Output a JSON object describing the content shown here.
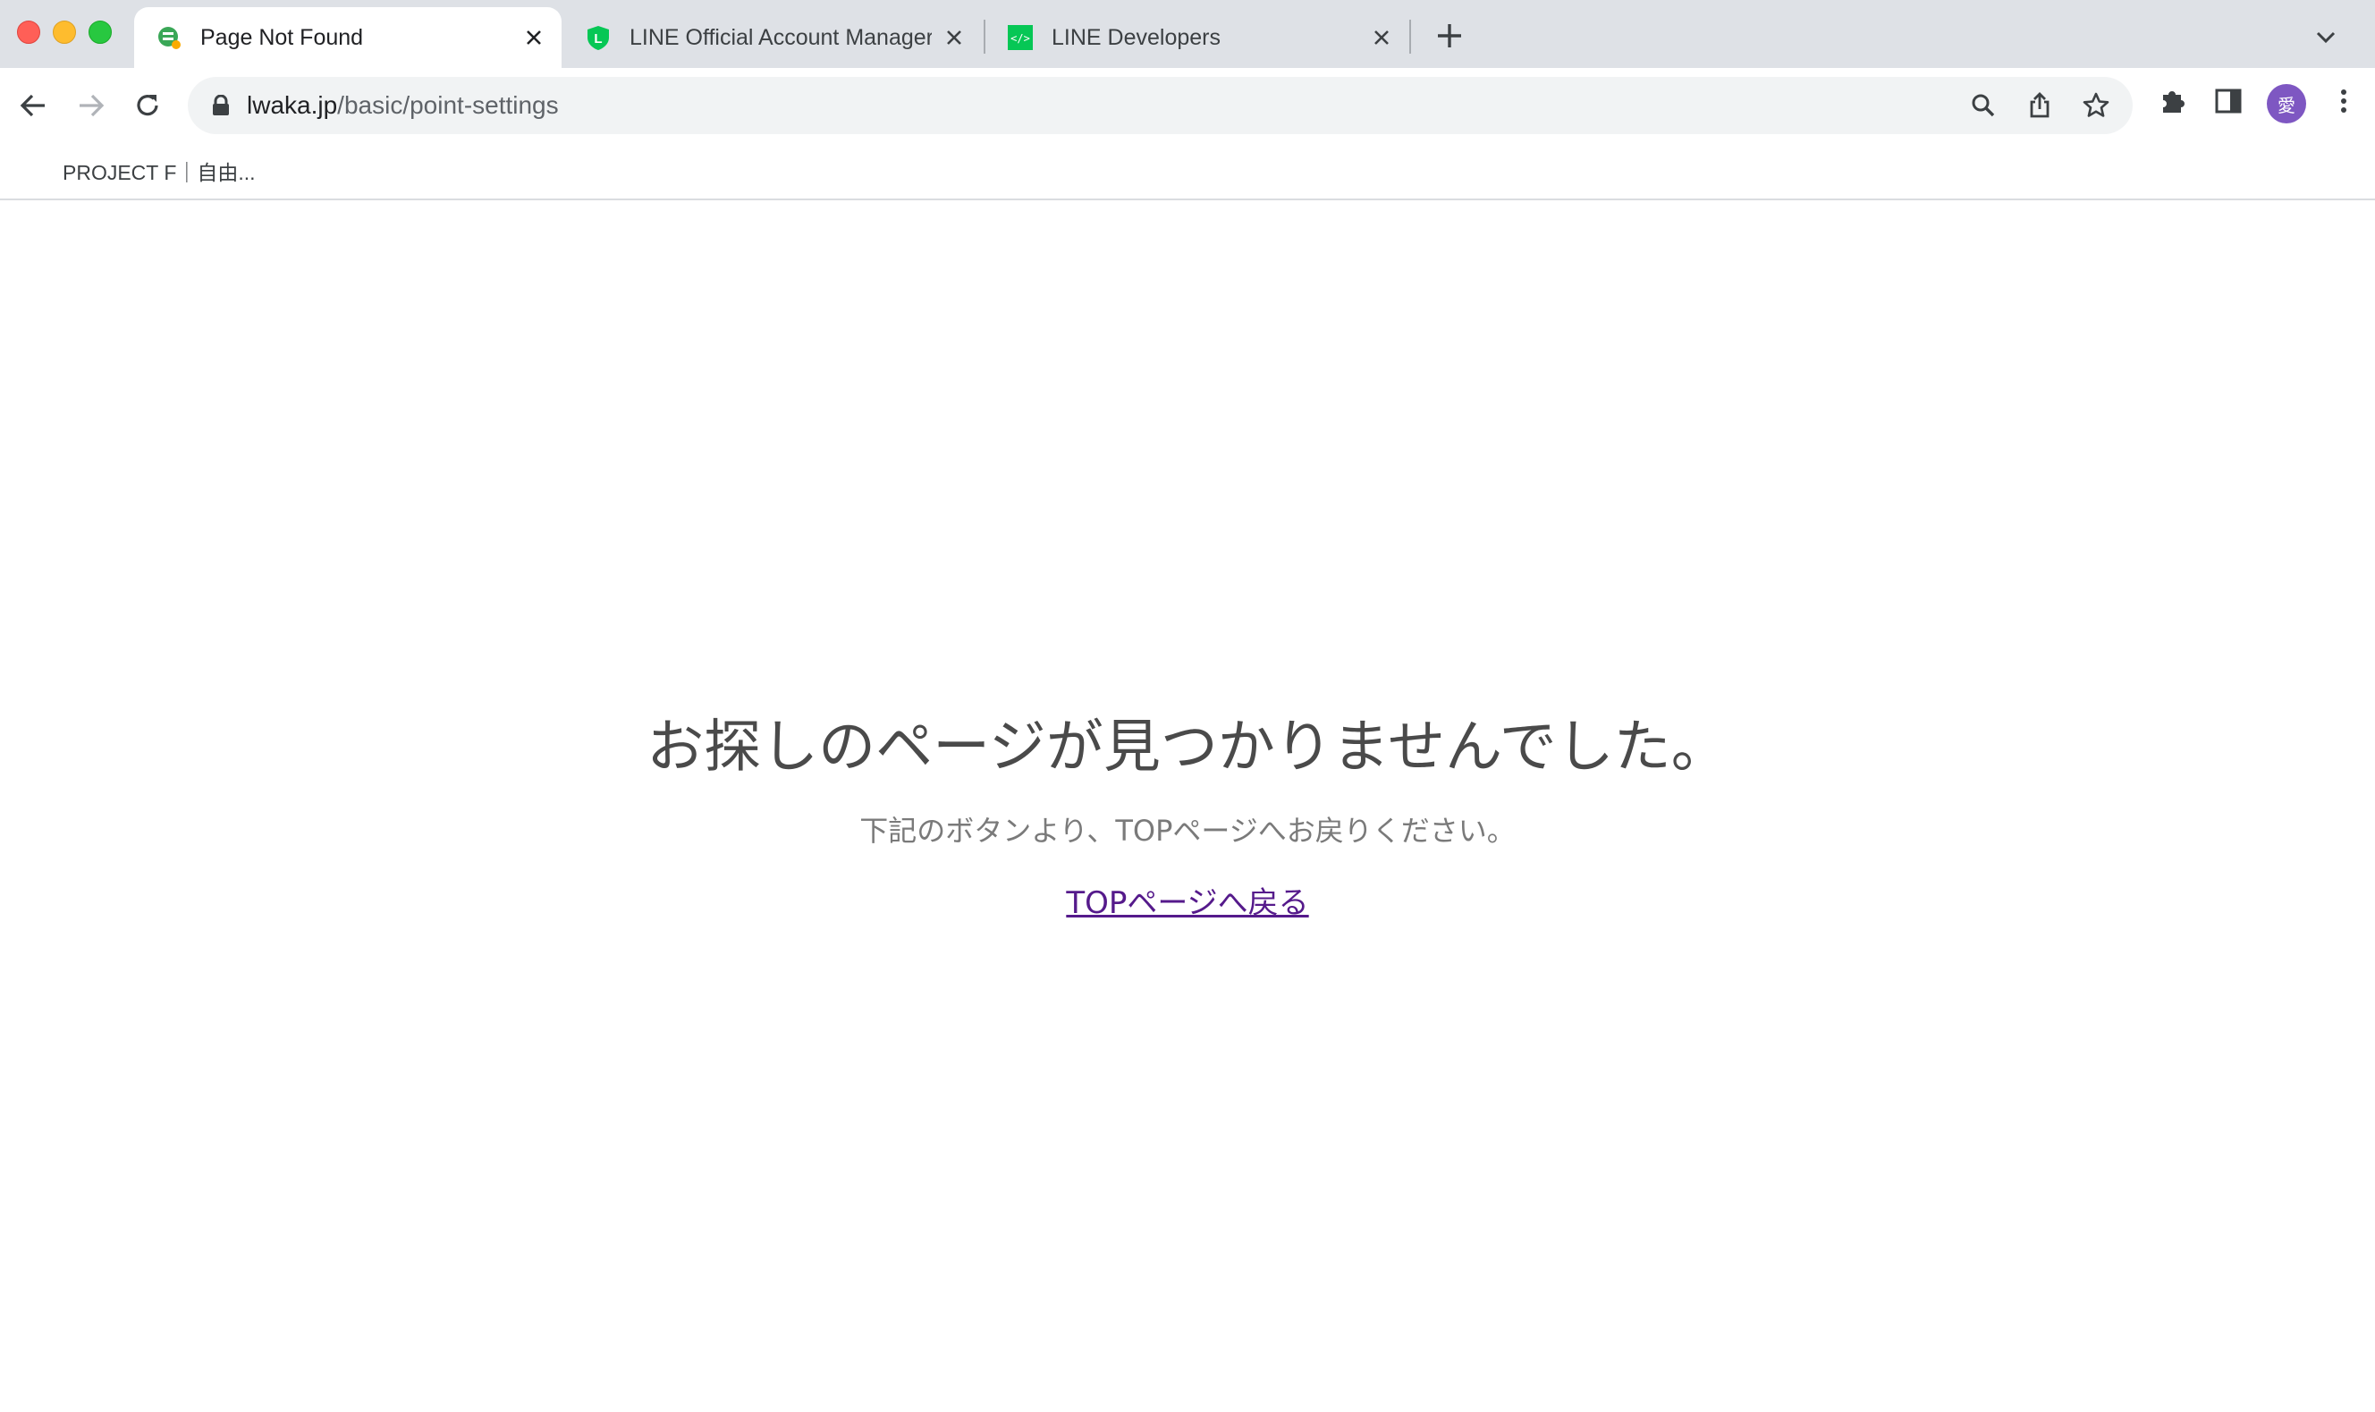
{
  "browser": {
    "tabs": [
      {
        "title": "Page Not Found",
        "active": true
      },
      {
        "title": "LINE Official Account Manager",
        "active": false
      },
      {
        "title": "LINE Developers",
        "active": false
      }
    ],
    "address_bar": {
      "domain": "lwaka.jp",
      "path": "/basic/point-settings"
    },
    "bookmarks": [
      {
        "label": "PROJECT F｜自由..."
      }
    ],
    "profile_initial": "愛"
  },
  "page": {
    "heading": "お探しのページが見つかりませんでした。",
    "subtext": "下記のボタンより、TOPページへお戻りください。",
    "top_link": "TOPページへ戻る"
  },
  "colors": {
    "tabstrip_bg": "#dee1e6",
    "link_visited": "#551a8b",
    "heading_text": "#4a4a4a",
    "avatar_bg": "#7e57c2"
  }
}
